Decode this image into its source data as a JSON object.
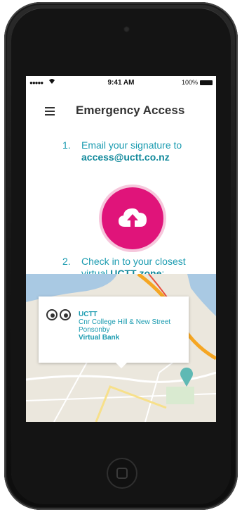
{
  "status_bar": {
    "signal": "●●●●●",
    "time": "9:41 AM",
    "battery_pct": "100%"
  },
  "nav": {
    "title": "Emergency Access",
    "menu_icon": "hamburger-menu-icon"
  },
  "step1": {
    "number": "1.",
    "text": "Email your signature to",
    "email": "access@uctt.co.nz"
  },
  "upload": {
    "icon": "cloud-upload-icon",
    "color": "#e0147a"
  },
  "step2": {
    "number": "2.",
    "text_line1": "Check in to your closest",
    "text_pre": "virtual",
    "zone": "UCTT zone",
    "text_post": ":"
  },
  "map": {
    "callout": {
      "brand": "UCTT",
      "address": "Cnr College Hill & New Street",
      "suburb": "Ponsonby",
      "type": "Virtual Bank",
      "icon": "eyes-icon"
    },
    "pin_color": "#5fb9b4"
  },
  "colors": {
    "accent": "#1a9bb0",
    "primary": "#e0147a"
  }
}
